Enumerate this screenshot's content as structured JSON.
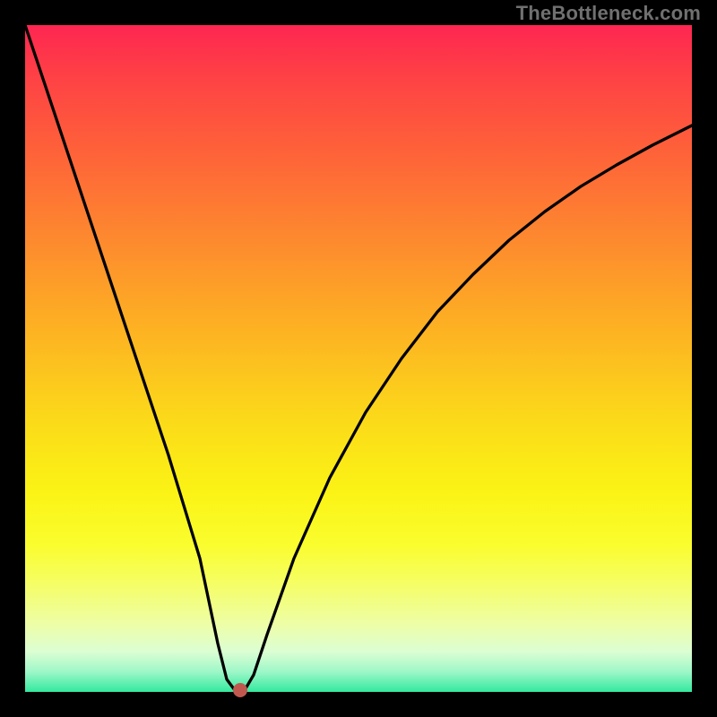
{
  "watermark": "TheBottleneck.com",
  "colors": {
    "frame": "#000000",
    "curve": "#000000",
    "marker": "#c1584f",
    "gradient_top": "#fe2651",
    "gradient_bottom": "#33e99e"
  },
  "chart_data": {
    "type": "line",
    "title": "",
    "xlabel": "",
    "ylabel": "",
    "xlim": [
      0,
      100
    ],
    "ylim": [
      0,
      100
    ],
    "x": [
      0,
      5,
      10,
      15,
      20,
      25,
      28,
      30,
      32,
      34,
      36,
      40,
      45,
      50,
      55,
      60,
      65,
      70,
      75,
      80,
      85,
      90,
      95,
      100
    ],
    "values": [
      100,
      84,
      68,
      52,
      36,
      20,
      7,
      1,
      0,
      2,
      8,
      20,
      32,
      42,
      50,
      57,
      63,
      68,
      72,
      76,
      79,
      82,
      84,
      86
    ],
    "marker": {
      "x": 32,
      "y": 0
    },
    "grid": false,
    "legend": false
  }
}
